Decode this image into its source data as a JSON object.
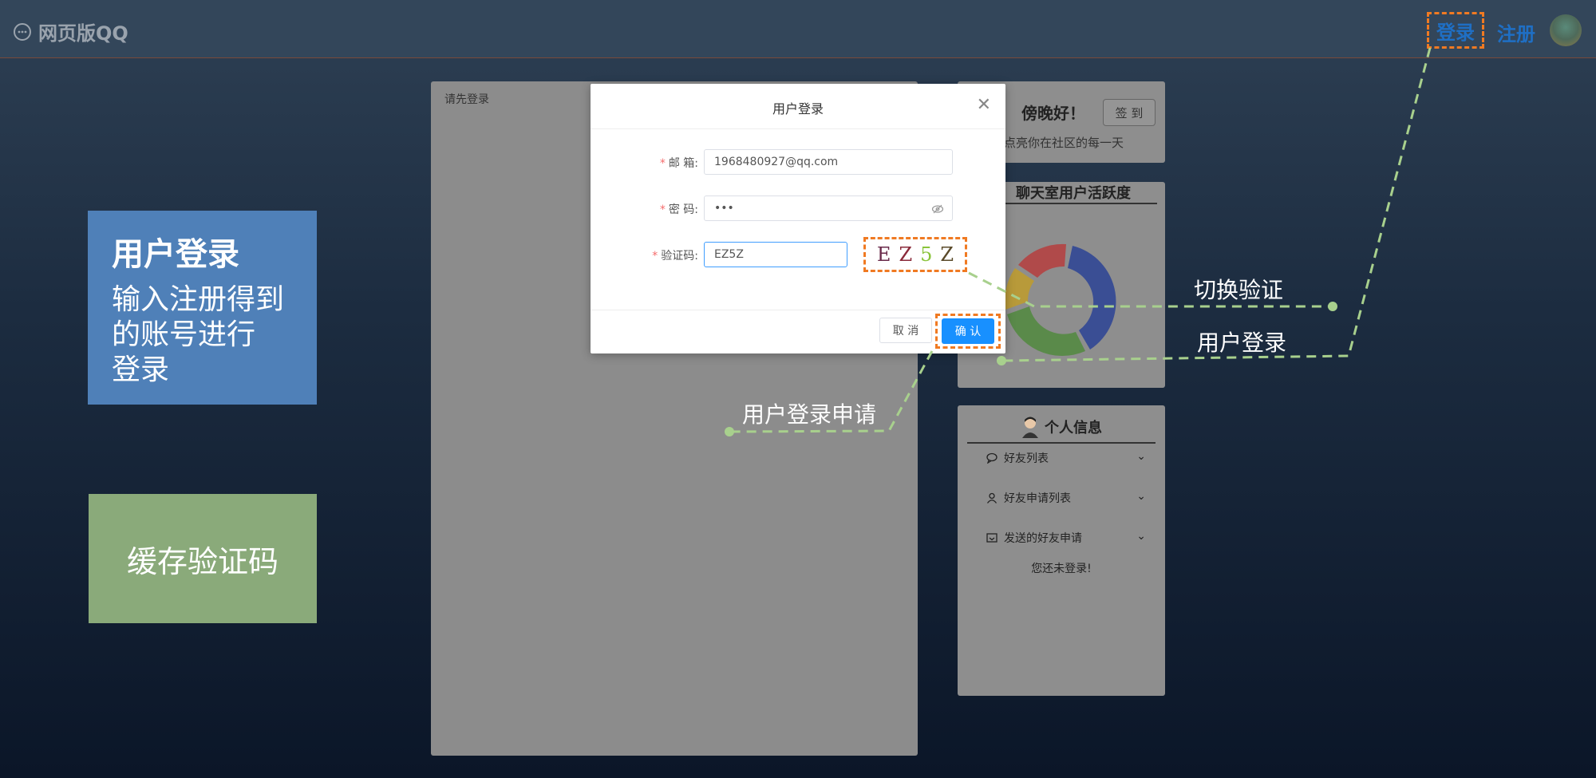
{
  "app": {
    "title": "网页版QQ",
    "logo_icon": "chat-bubble-icon"
  },
  "nav": {
    "login": "登录",
    "register": "注册"
  },
  "callouts": {
    "login_heading": "用户登录",
    "login_desc_lines": [
      "输入注册得到",
      "的账号进行",
      "登录"
    ],
    "cache_captcha": "缓存验证码"
  },
  "chat": {
    "hint": "请先登录"
  },
  "greeting": {
    "title": "傍晚好！",
    "subtitle": "点亮你在社区的每一天",
    "checkin": "签 到"
  },
  "activity": {
    "title": "聊天室用户活跃度"
  },
  "profile": {
    "title": "个人信息",
    "menu": [
      {
        "label": "好友列表",
        "icon": "chat-icon"
      },
      {
        "label": "好友申请列表",
        "icon": "user-icon"
      },
      {
        "label": "发送的好友申请",
        "icon": "inbox-icon"
      }
    ],
    "status": "您还未登录!"
  },
  "dialog": {
    "title": "用户登录",
    "email_label": "邮 箱:",
    "email_value": "1968480927@qq.com",
    "password_label": "密 码:",
    "password_value": "•••",
    "captcha_label": "验证码:",
    "captcha_value": "EZ5Z",
    "captcha_chars": [
      "E",
      "Z",
      "5",
      "Z"
    ],
    "cancel": "取 消",
    "confirm": "确 认"
  },
  "annotations": {
    "switch_captcha": "切换验证",
    "user_login": "用户登录",
    "login_request": "用户登录申请"
  },
  "colors": {
    "accent_dashed": "#f07a22",
    "annotation_line": "#a8d08d",
    "primary_button": "#1890ff",
    "callout_blue": "#4f80b8",
    "callout_green": "#8aaa7a"
  }
}
